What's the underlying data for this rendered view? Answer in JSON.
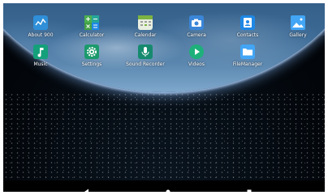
{
  "apps": [
    {
      "label": "About 900",
      "icon": "chart-icon",
      "color": "#2f8fd8"
    },
    {
      "label": "Calculator",
      "icon": "calculator-icon",
      "color": "#2aa86b"
    },
    {
      "label": "Calendar",
      "icon": "calendar-icon",
      "color": "#7cb342"
    },
    {
      "label": "Camera",
      "icon": "camera-icon",
      "color": "#3a86d8"
    },
    {
      "label": "Contacts",
      "icon": "contacts-icon",
      "color": "#1e88e5"
    },
    {
      "label": "Gallery",
      "icon": "gallery-icon",
      "color": "#42a5f5"
    },
    {
      "label": "Music",
      "icon": "music-icon",
      "color": "#14a07a"
    },
    {
      "label": "Settings",
      "icon": "gear-icon",
      "color": "#1b9a6c"
    },
    {
      "label": "Sound Recorder",
      "icon": "microphone-icon",
      "color": "#168a6e"
    },
    {
      "label": "Videos",
      "icon": "play-icon",
      "color": "#1db07a"
    },
    {
      "label": "FileManager",
      "icon": "folder-icon",
      "color": "#42a5f5"
    }
  ],
  "navbar": {
    "back": "back-icon",
    "home": "home-icon",
    "recents": "recents-icon"
  }
}
